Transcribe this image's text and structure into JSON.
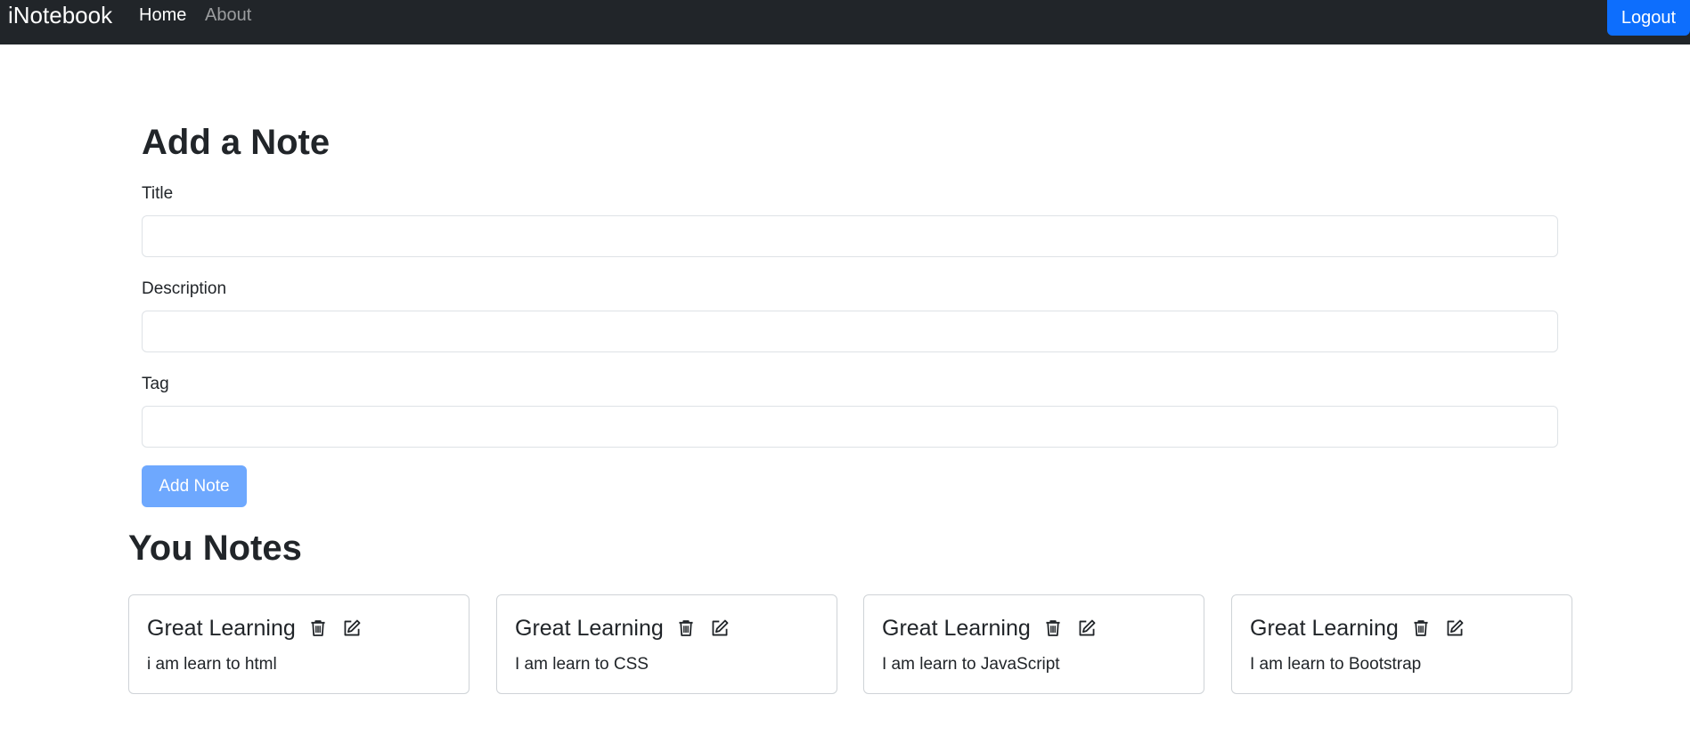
{
  "navbar": {
    "brand": "iNotebook",
    "links": [
      {
        "label": "Home",
        "active": true
      },
      {
        "label": "About",
        "active": false
      }
    ],
    "logout_label": "Logout"
  },
  "form": {
    "heading": "Add a Note",
    "title_label": "Title",
    "title_value": "",
    "description_label": "Description",
    "description_value": "",
    "tag_label": "Tag",
    "tag_value": "",
    "submit_label": "Add Note"
  },
  "notes": {
    "heading": "You Notes",
    "items": [
      {
        "title": "Great Learning",
        "description": "i am learn to html"
      },
      {
        "title": "Great Learning",
        "description": "I am learn to CSS"
      },
      {
        "title": "Great Learning",
        "description": "I am learn to JavaScript"
      },
      {
        "title": "Great Learning",
        "description": "I am learn to Bootstrap"
      }
    ]
  },
  "icons": {
    "delete": "trash-icon",
    "edit": "edit-icon"
  },
  "colors": {
    "navbar_bg": "#212529",
    "primary": "#0d6efd",
    "primary_disabled": "#6ea8fe"
  }
}
